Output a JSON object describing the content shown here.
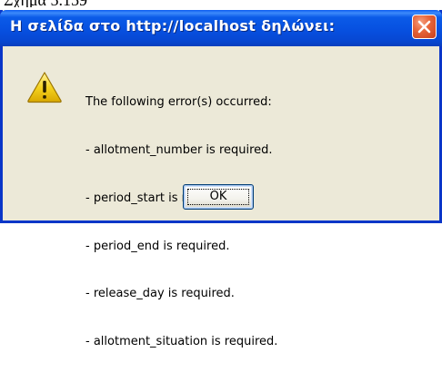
{
  "caption": {
    "text": "Σχήμα 5.159"
  },
  "dialog": {
    "title": "Η σελίδα στο http://localhost δηλώνει:",
    "icon": "warning-icon",
    "message_lines": [
      "The following error(s) occurred:",
      "- allotment_number is required.",
      "- period_start is required.",
      "- period_end is required.",
      "- release_day is required.",
      "- allotment_situation is required."
    ],
    "ok_label": "OK",
    "close_icon": "close-icon"
  },
  "colors": {
    "titlebar": "#0750e0",
    "body": "#ece9d8",
    "close": "#e8663b",
    "warning": "#f5d320"
  }
}
